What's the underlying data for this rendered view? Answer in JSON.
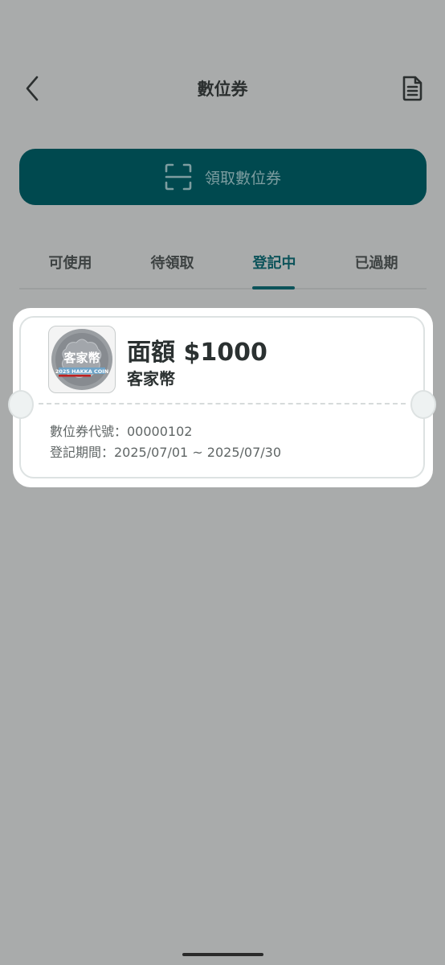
{
  "header": {
    "title": "數位券",
    "back_icon": "chevron-left-icon",
    "doc_icon": "document-icon"
  },
  "claim_button": {
    "label": "領取數位券",
    "icon": "scan-icon"
  },
  "tabs": [
    {
      "label": "可使用",
      "active": false
    },
    {
      "label": "待領取",
      "active": false
    },
    {
      "label": "登記中",
      "active": true
    },
    {
      "label": "已過期",
      "active": false
    }
  ],
  "voucher": {
    "amount": "面額 $1000",
    "name": "客家幣",
    "coin_text": "客家幣",
    "coin_subtext": "2025 HAKKA COIN",
    "code": "數位券代號：00000102",
    "period": "登記期間：2025/07/01 ~ 2025/07/30"
  },
  "colors": {
    "accent": "#00494f",
    "tab_active": "#0c535a",
    "background": "#a9abab"
  }
}
